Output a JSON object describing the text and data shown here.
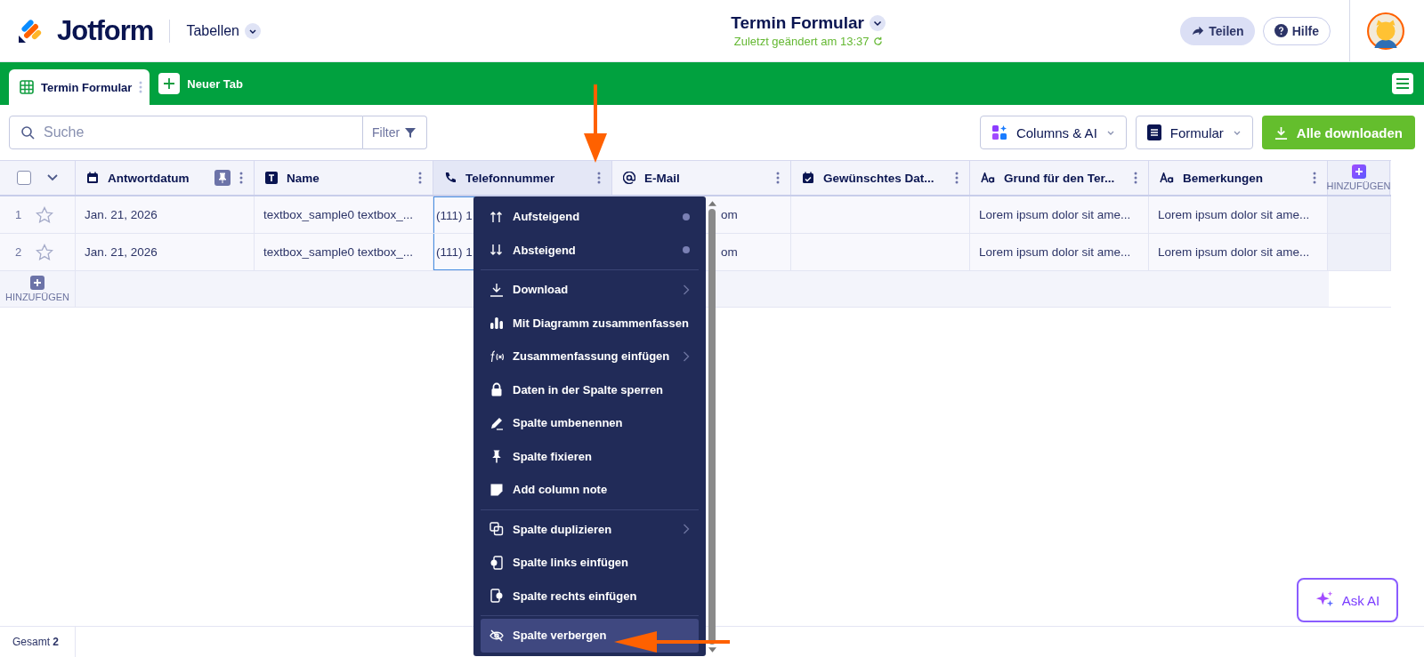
{
  "header": {
    "logo": "Jotform",
    "section": "Tabellen",
    "title": "Termin Formular",
    "subtitle": "Zuletzt geändert am 13:37",
    "buttons": [
      "Teilen",
      "Hilfe"
    ]
  },
  "tabs": [
    {
      "label": "Termin Formular",
      "selected": true
    },
    {
      "label": "Neuer Tab",
      "selected": false
    }
  ],
  "toolbar": {
    "search_placeholder": "Suche",
    "filter": "Filter",
    "buttons": [
      "Columns & AI",
      "Formular",
      "Alle downloaden"
    ]
  },
  "table": {
    "all_selected": false,
    "columns": [
      {
        "label": "Antwortdatum",
        "kind": "date",
        "pinned": true,
        "selected": false
      },
      {
        "label": "Name",
        "kind": "text",
        "pinned": false,
        "selected": false
      },
      {
        "label": "Telefonnummer",
        "kind": "phone",
        "pinned": false,
        "selected": true
      },
      {
        "label": "E-Mail",
        "kind": "email",
        "pinned": false,
        "selected": false
      },
      {
        "label": "Gewünschtes Dat...",
        "kind": "calendar",
        "pinned": false,
        "selected": false
      },
      {
        "label": "Grund für den Ter...",
        "kind": "long",
        "pinned": false,
        "selected": false
      },
      {
        "label": "Bemerkungen",
        "kind": "long",
        "pinned": false,
        "selected": false
      }
    ],
    "add_column": "HINZUFÜGEN",
    "rows": [
      {
        "index": "1",
        "starred": false,
        "cells": [
          "Jan. 21, 2026",
          "textbox_sample0 textbox_...",
          "(111) 1",
          "om",
          null,
          "Lorem ipsum dolor sit ame...",
          "Lorem ipsum dolor sit ame..."
        ]
      },
      {
        "index": "2",
        "starred": false,
        "cells": [
          "Jan. 21, 2026",
          "textbox_sample0 textbox_...",
          "(111) 1",
          "om",
          null,
          "Lorem ipsum dolor sit ame...",
          "Lorem ipsum dolor sit ame..."
        ]
      }
    ],
    "add_row": "HINZUFÜGEN"
  },
  "menu": {
    "groups": [
      [
        {
          "label": "Aufsteigend",
          "kind": "sort",
          "selected": false
        },
        {
          "label": "Absteigend",
          "kind": "sort",
          "selected": false
        }
      ],
      [
        {
          "label": "Download",
          "kind": "submenu",
          "selected": false
        },
        {
          "label": "Mit Diagramm zusammenfassen",
          "kind": "action",
          "selected": false
        },
        {
          "label": "Zusammenfassung einfügen",
          "kind": "submenu",
          "selected": false
        },
        {
          "label": "Daten in der Spalte sperren",
          "kind": "action",
          "selected": false
        },
        {
          "label": "Spalte umbenennen",
          "kind": "action",
          "selected": false
        },
        {
          "label": "Spalte fixieren",
          "kind": "action",
          "selected": false
        },
        {
          "label": "Add column note",
          "kind": "action",
          "selected": false
        }
      ],
      [
        {
          "label": "Spalte duplizieren",
          "kind": "submenu",
          "selected": false
        },
        {
          "label": "Spalte links einfügen",
          "kind": "action",
          "selected": false
        },
        {
          "label": "Spalte rechts einfügen",
          "kind": "action",
          "selected": false
        }
      ],
      [
        {
          "label": "Spalte verbergen",
          "kind": "action",
          "selected": true
        }
      ]
    ]
  },
  "footer": {
    "total": "Gesamt **2**"
  },
  "ask_ai": "Ask AI"
}
